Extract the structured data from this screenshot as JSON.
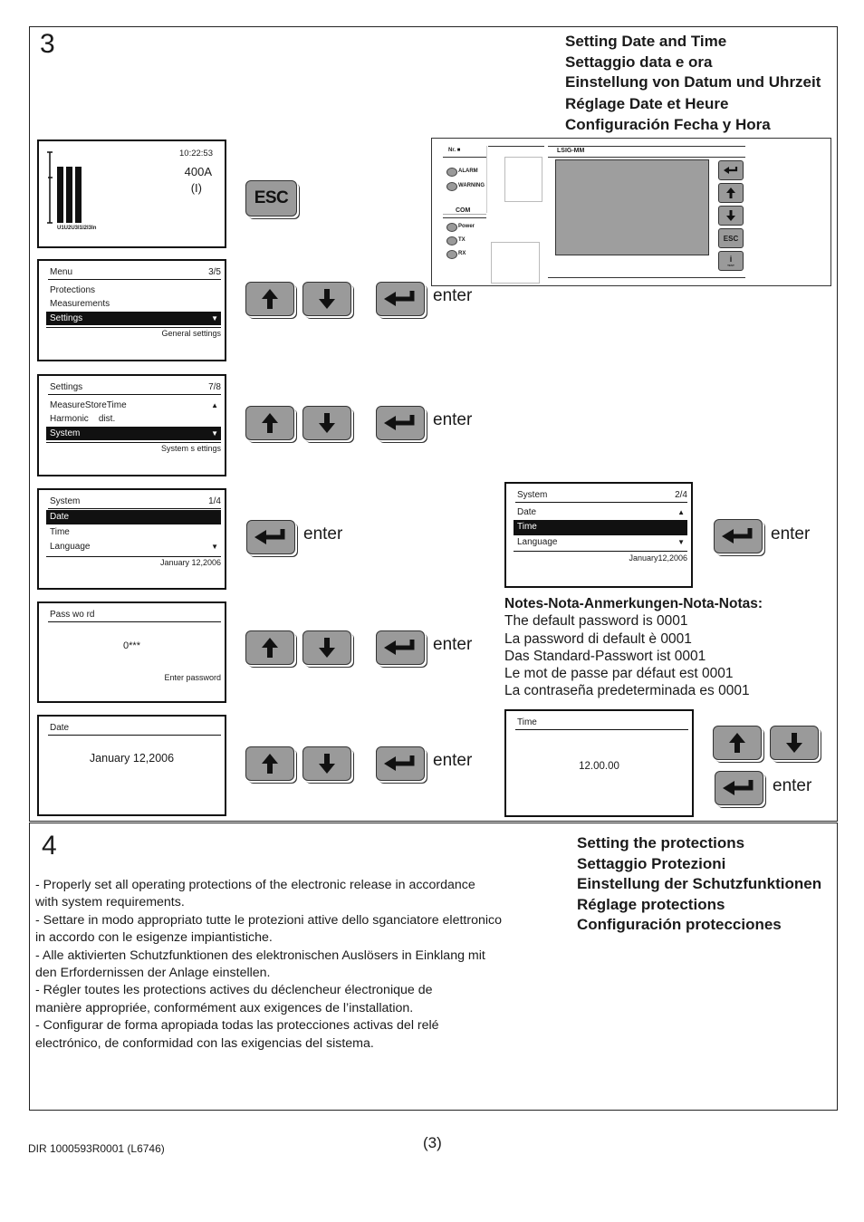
{
  "step3": {
    "number": "3",
    "titles": [
      "Setting Date and Time",
      "Settaggio data e ora",
      "Einstellung von Datum und Uhrzeit",
      "Réglage Date et Heure",
      "Configuración Fecha y Hora"
    ],
    "home_screen": {
      "time": "10:22:53",
      "current": "400A",
      "phase": "(I)",
      "bar_labels": "U1U2U3I1I2I3In"
    },
    "device": {
      "nr_label": "Nr. ■",
      "model": "LSIG-MM",
      "leds": [
        "ALARM",
        "WARNING"
      ],
      "com_label": "COM",
      "com_leds": [
        "Power",
        "TX",
        "RX"
      ],
      "keys": [
        "enter",
        "up",
        "down",
        "ESC",
        "i TEST"
      ],
      "esc_label": "ESC",
      "test_label": "TEST"
    },
    "esc_key_label": "ESC",
    "enter_label": "enter",
    "menu_screen": {
      "title": "Menu",
      "page": "3/5",
      "items": [
        "Protections",
        "Measurements",
        "Settings"
      ],
      "selected": 2,
      "footer": "General settings"
    },
    "settings_screen": {
      "title": "Settings",
      "page": "7/8",
      "items": [
        "MeasureStoreTime",
        "Harmonic    dist.",
        "System"
      ],
      "selected": 2,
      "footer": "System s ettings"
    },
    "system_screen_1": {
      "title": "System",
      "page": "1/4",
      "items": [
        "Date",
        "Time",
        "Language"
      ],
      "selected": 0,
      "footer": "January 12,2006"
    },
    "system_screen_2": {
      "title": "System",
      "page": "2/4",
      "items": [
        "Date",
        "Time",
        "Language"
      ],
      "selected": 1,
      "footer": "January12,2006"
    },
    "password_screen": {
      "title": "Pass wo rd",
      "value": "0***",
      "footer": "Enter password"
    },
    "date_screen": {
      "title": "Date",
      "value": "January 12,2006"
    },
    "time_screen": {
      "title": "Time",
      "value": "12.00.00"
    },
    "notes": {
      "heading": "Notes-Nota-Anmerkungen-Nota-Notas:",
      "lines": [
        "The default password is 0001",
        "La password di default è 0001",
        "Das Standard-Passwort ist 0001",
        "Le mot de passe par défaut est 0001",
        "La contraseña predeterminada es 0001"
      ]
    }
  },
  "step4": {
    "number": "4",
    "titles": [
      "Setting the protections",
      "Settaggio Protezioni",
      "Einstellung der Schutzfunktionen",
      "Réglage protections",
      "Configuración protecciones"
    ],
    "paragraph_lines": [
      "- Properly set all operating protections of the electronic release in accordance",
      "with system requirements.",
      "- Settare in modo appropriato tutte le protezioni attive dello sganciatore elettronico",
      "in accordo con le esigenze impiantistiche.",
      "- Alle aktivierten Schutzfunktionen des elektronischen Auslösers in Einklang mit",
      "den Erfordernissen der Anlage einstellen.",
      "- Régler toutes les protections actives du déclencheur électronique de",
      "manière appropriée, conformément aux exigences de l’installation.",
      "- Configurar de forma apropiada todas las protecciones activas del relé",
      "electrónico, de conformidad con las exigencias del sistema."
    ]
  },
  "footer": {
    "doc_id": "DIR 1000593R0001 (L6746)",
    "page": "(3)"
  }
}
